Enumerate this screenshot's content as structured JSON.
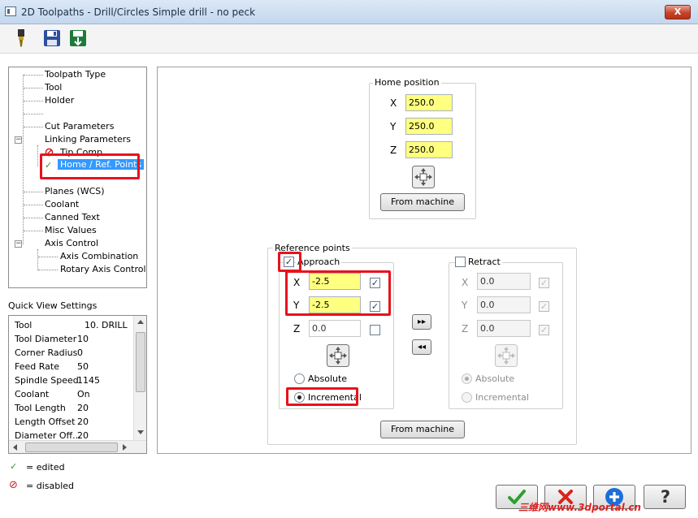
{
  "window": {
    "title": "2D Toolpaths - Drill/Circles Simple drill - no peck",
    "close_label": "X"
  },
  "toolbar": {
    "icons": [
      "drill-tool-icon",
      "save-icon",
      "save-to-machine-icon"
    ]
  },
  "tree": {
    "items": [
      "Toolpath Type",
      "Tool",
      "Holder",
      "",
      "Cut Parameters",
      "Linking Parameters",
      "Tip Comp",
      "Home / Ref. Points",
      "Planes (WCS)",
      "Coolant",
      "Canned Text",
      "Misc Values",
      "Axis Control",
      "Axis Combination",
      "Rotary Axis Control"
    ],
    "expand_glyph": "−",
    "edited_check": "✓"
  },
  "quick_view": {
    "title": "Quick View Settings",
    "rows": [
      {
        "key": "Tool",
        "value": "10. DRILL"
      },
      {
        "key": "Tool Diameter",
        "value": "10"
      },
      {
        "key": "Corner Radius",
        "value": "0"
      },
      {
        "key": "Feed Rate",
        "value": "50"
      },
      {
        "key": "Spindle Speed",
        "value": "1145"
      },
      {
        "key": "Coolant",
        "value": "On"
      },
      {
        "key": "Tool Length",
        "value": "20"
      },
      {
        "key": "Length Offset",
        "value": "20"
      },
      {
        "key": "Diameter Off...",
        "value": "20"
      }
    ]
  },
  "legend": {
    "edited_label": "= edited",
    "disabled_label": "= disabled",
    "edited_glyph": "✓",
    "disabled_glyph": "⊘"
  },
  "home_position": {
    "title": "Home position",
    "x_label": "X",
    "x_value": "250.0",
    "y_label": "Y",
    "y_value": "250.0",
    "z_label": "Z",
    "z_value": "250.0",
    "from_machine_label": "From machine"
  },
  "reference_points": {
    "title": "Reference points",
    "approach": {
      "label": "Approach",
      "checked": "✓",
      "x_label": "X",
      "x_value": "-2.5",
      "x_check": "✓",
      "y_label": "Y",
      "y_value": "-2.5",
      "y_check": "✓",
      "z_label": "Z",
      "z_value": "0.0",
      "z_check": "",
      "absolute_label": "Absolute",
      "incremental_label": "Incremental"
    },
    "retract": {
      "label": "Retract",
      "checked": "",
      "x_label": "X",
      "x_value": "0.0",
      "x_check": "✓",
      "y_label": "Y",
      "y_value": "0.0",
      "y_check": "✓",
      "z_label": "Z",
      "z_value": "0.0",
      "z_check": "✓",
      "absolute_label": "Absolute",
      "incremental_label": "Incremental"
    },
    "copy_right_label": "▸▸",
    "copy_left_label": "◂◂",
    "from_machine_label": "From machine"
  },
  "footer": {
    "ok_icon": "ok-check-icon",
    "cancel_icon": "cancel-x-icon",
    "add_icon": "add-plus-icon",
    "help_label": "?"
  },
  "watermark": "三维网www.3dportal.cn"
}
